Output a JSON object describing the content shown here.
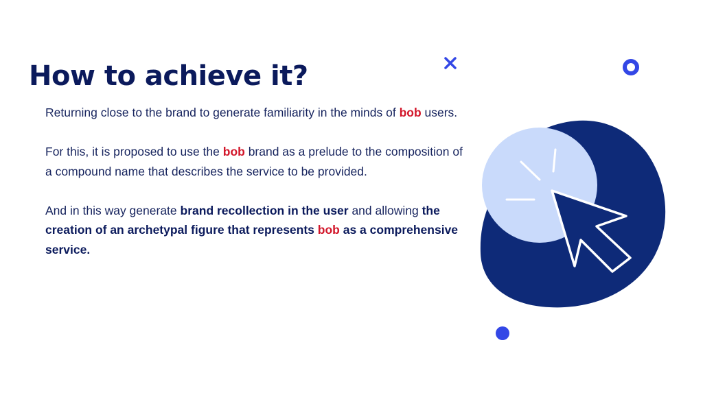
{
  "slide": {
    "title": "How to achieve it?",
    "paragraphs": [
      [
        {
          "text": " Returning close to the brand to generate familiarity in the minds of "
        },
        {
          "text": "bob",
          "style": "brand"
        },
        {
          "text": " users."
        }
      ],
      [
        {
          "text": "For this, it is proposed to use the "
        },
        {
          "text": "bob",
          "style": "brand"
        },
        {
          "text": " brand as a prelude to the composition of a compound name that describes the service to be provided."
        }
      ],
      [
        {
          "text": "And in this way generate "
        },
        {
          "text": "brand recollection in the user",
          "style": "strong"
        },
        {
          "text": " and allowing "
        },
        {
          "text": "the creation of an archetypal figure that represents ",
          "style": "strong"
        },
        {
          "text": "bob",
          "style": "brand"
        },
        {
          "text": " as a comprehensive service.",
          "style": "strong"
        }
      ]
    ]
  },
  "icons": {
    "decor_cross": "close-icon",
    "decor_ring": "ring-icon",
    "decor_dot": "dot-icon",
    "main_illustration": "click-cursor-icon"
  },
  "colors": {
    "navy": "#0b1a5c",
    "blob": "#0e2a78",
    "light_circle": "#c9dafb",
    "brand_red": "#d2162a",
    "accent_blue": "#3347e6"
  }
}
